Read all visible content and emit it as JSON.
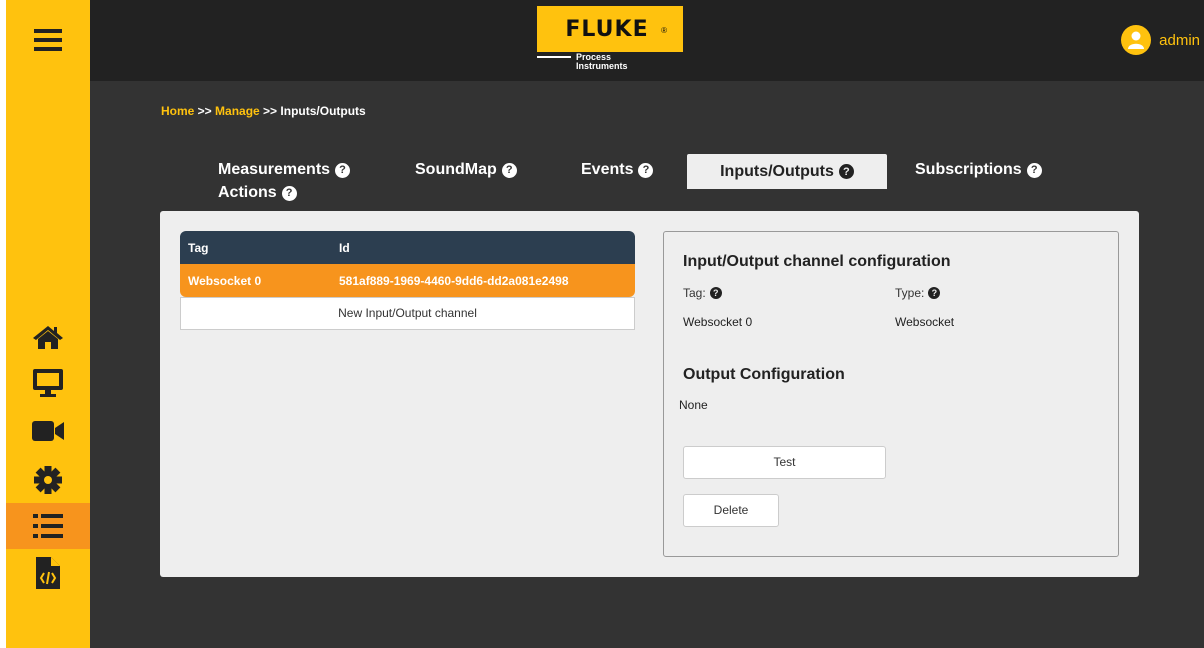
{
  "header": {
    "logo_brand": "FLUKE",
    "logo_reg": "®",
    "logo_sub_line1": "Process",
    "logo_sub_line2": "Instruments",
    "user_name": "admin"
  },
  "sidebar": {
    "items": [
      {
        "icon": "hamburger-menu-icon"
      },
      {
        "icon": "home-icon"
      },
      {
        "icon": "monitor-icon"
      },
      {
        "icon": "video-camera-icon"
      },
      {
        "icon": "gear-icon"
      },
      {
        "icon": "list-icon",
        "active": true
      },
      {
        "icon": "code-file-icon"
      }
    ]
  },
  "breadcrumb": {
    "home": "Home",
    "sep1": " >> ",
    "manage": "Manage",
    "sep2": " >> ",
    "current": "Inputs/Outputs"
  },
  "tabs": [
    {
      "label": "Measurements"
    },
    {
      "label": "SoundMap"
    },
    {
      "label": "Events"
    },
    {
      "label": "Inputs/Outputs",
      "active": true
    },
    {
      "label": "Subscriptions"
    },
    {
      "label": "Actions"
    }
  ],
  "help_glyph": "?",
  "table": {
    "columns": [
      "Tag",
      "Id"
    ],
    "rows": [
      {
        "tag": "Websocket 0",
        "id": "581af889-1969-4460-9dd6-dd2a081e2498"
      }
    ],
    "new_label": "New Input/Output channel"
  },
  "config": {
    "title": "Input/Output channel configuration",
    "tag_label": "Tag:",
    "type_label": "Type:",
    "tag_value": "Websocket 0",
    "type_value": "Websocket",
    "output_title": "Output Configuration",
    "output_value": "None",
    "test_label": "Test",
    "delete_label": "Delete"
  },
  "colors": {
    "accent_yellow": "#FFC20E",
    "accent_orange": "#F7941D",
    "header_bg": "#222222",
    "main_bg": "#333333",
    "table_head": "#2C3E50"
  }
}
